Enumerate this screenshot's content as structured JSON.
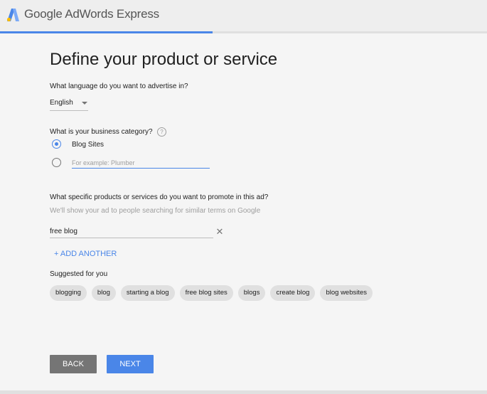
{
  "header": {
    "brand": "Google AdWords Express",
    "logo_icon": "adwords-logo-icon",
    "progress_fraction": 0.437
  },
  "main": {
    "title": "Define your product or service",
    "language": {
      "question": "What language do you want to advertise in?",
      "selected": "English"
    },
    "category": {
      "question": "What is your business category?",
      "selected_option": "Blog Sites",
      "other_placeholder": "For example: Plumber"
    },
    "products": {
      "question": "What specific products or services do you want to promote in this ad?",
      "hint": "We'll show your ad to people searching for similar terms on Google",
      "keyword_value": "free blog",
      "add_another": "+ ADD ANOTHER"
    },
    "suggestions": {
      "label": "Suggested for you",
      "chips": [
        "blogging",
        "blog",
        "starting a blog",
        "free blog sites",
        "blogs",
        "create blog",
        "blog websites"
      ]
    }
  },
  "footer": {
    "back_label": "BACK",
    "next_label": "NEXT"
  },
  "colors": {
    "accent": "#4a86e8",
    "back_button": "#757575",
    "chip_bg": "#e0e0e0"
  }
}
